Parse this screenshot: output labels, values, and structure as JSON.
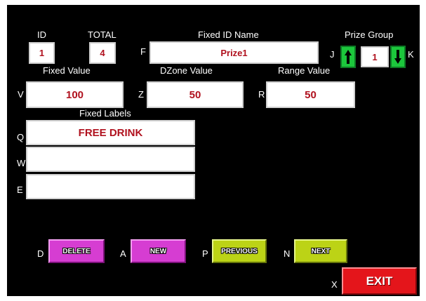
{
  "colors": {
    "background": "#000000",
    "field_text": "#b0111e",
    "delete_new_buttons": "#d63dd2",
    "previous_next_buttons": "#bcd316",
    "exit_button": "#e4151b",
    "prize_group_arrows": "#1cc73c"
  },
  "labels": {
    "id": "ID",
    "total": "TOTAL",
    "fixed_id_name": "Fixed ID Name",
    "prize_group": "Prize Group",
    "fixed_value": "Fixed Value",
    "dzone_value": "DZone Value",
    "range_value": "Range Value",
    "fixed_labels": "Fixed Labels"
  },
  "keys": {
    "f": "F",
    "j": "J",
    "k": "K",
    "v": "V",
    "z": "Z",
    "r": "R",
    "q": "Q",
    "w": "W",
    "e": "E",
    "d": "D",
    "a": "A",
    "p": "P",
    "n": "N",
    "x": "X"
  },
  "fields": {
    "id": "1",
    "total": "4",
    "fixed_id_name": "Prize1",
    "prize_group": "1",
    "fixed_value": "100",
    "dzone_value": "50",
    "range_value": "50",
    "fixed_label_1": "FREE DRINK",
    "fixed_label_2": "",
    "fixed_label_3": ""
  },
  "icons": {
    "prize_group_up": "arrow-up-icon",
    "prize_group_down": "arrow-down-icon"
  },
  "buttons": {
    "delete": "DELETE",
    "new": "NEW",
    "previous": "PREVIOUS",
    "next": "NEXT",
    "exit": "EXIT"
  }
}
